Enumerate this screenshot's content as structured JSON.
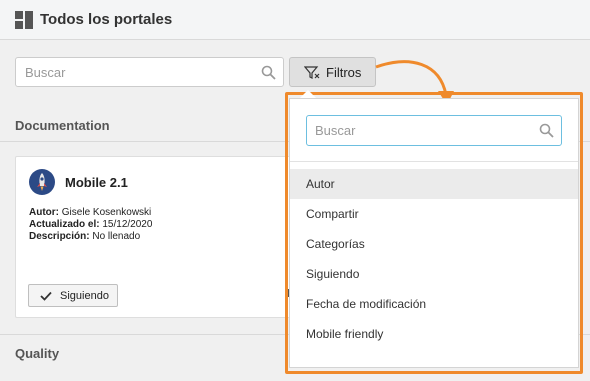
{
  "header": {
    "title": "Todos los portales",
    "icon": "grid-icon"
  },
  "search": {
    "placeholder": "Buscar",
    "icon": "search-icon"
  },
  "filter_button": {
    "label": "Filtros",
    "icon": "filter-icon"
  },
  "sections": [
    {
      "title": "Documentation"
    },
    {
      "title": "Quality"
    }
  ],
  "card": {
    "title": "Mobile 2.1",
    "icon": "rocket-icon",
    "author_label": "Autor:",
    "author": "Gisele Kosenkowski",
    "updated_label": "Actualizado el:",
    "updated": "15/12/2020",
    "description_label": "Descripción:",
    "description": "No llenado",
    "follow_label": "Siguiendo",
    "follow_icon": "check-icon"
  },
  "dropdown": {
    "search_placeholder": "Buscar",
    "items": [
      {
        "label": "Autor"
      },
      {
        "label": "Compartir"
      },
      {
        "label": "Categorías"
      },
      {
        "label": "Siguiendo"
      },
      {
        "label": "Fecha de modificación"
      },
      {
        "label": "Mobile friendly"
      }
    ]
  },
  "colors": {
    "highlight": "#ef8a2c",
    "focus": "#6dbfe0"
  }
}
